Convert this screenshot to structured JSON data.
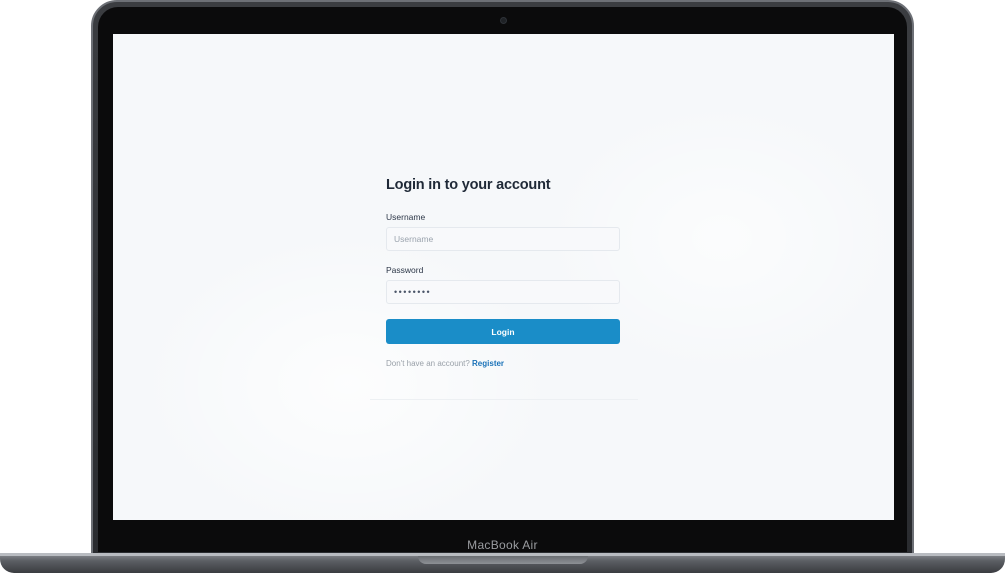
{
  "device": {
    "brand_label": "MacBook Air"
  },
  "login": {
    "title": "Login in to your account",
    "username_label": "Username",
    "username_placeholder": "Username",
    "username_value": "",
    "password_label": "Password",
    "password_value": "••••••••",
    "button_label": "Login",
    "no_account_text": "Don't have an account? ",
    "register_link": "Register"
  },
  "colors": {
    "accent": "#1a8dc8",
    "link": "#1a72b8",
    "screen_background": "#f6f8fa"
  }
}
